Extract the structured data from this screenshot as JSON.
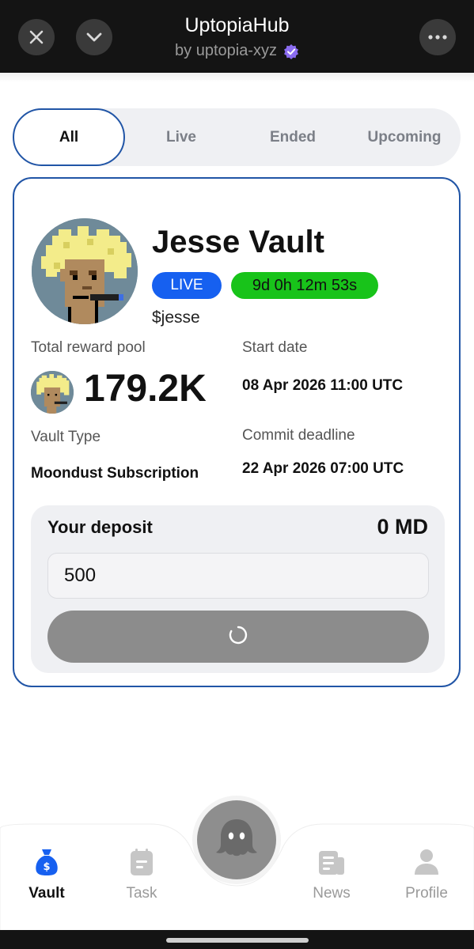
{
  "header": {
    "title": "UptopiaHub",
    "subtitle": "by uptopia-xyz",
    "close_icon": "close-icon",
    "collapse_icon": "chevron-down-icon",
    "more_icon": "more-icon"
  },
  "tabs": [
    {
      "label": "All",
      "active": true
    },
    {
      "label": "Live",
      "active": false
    },
    {
      "label": "Ended",
      "active": false
    },
    {
      "label": "Upcoming",
      "active": false
    }
  ],
  "vault": {
    "name": "Jesse Vault",
    "status": "LIVE",
    "countdown": "9d 0h 12m 53s",
    "ticker": "$jesse",
    "reward_pool_label": "Total reward pool",
    "reward_pool_value": "179.2K",
    "start_date_label": "Start date",
    "start_date_value": "08 Apr 2026 11:00 UTC",
    "vault_type_label": "Vault Type",
    "vault_type_value": "Moondust Subscription",
    "commit_deadline_label": "Commit deadline",
    "commit_deadline_value": "22 Apr 2026 07:00 UTC",
    "deposit": {
      "label": "Your deposit",
      "value": "0 MD",
      "input_value": "500"
    }
  },
  "nav": {
    "items": [
      {
        "label": "Vault",
        "icon": "money-bag-icon",
        "active": true
      },
      {
        "label": "Task",
        "icon": "task-icon",
        "active": false
      },
      {
        "label": "News",
        "icon": "news-icon",
        "active": false
      },
      {
        "label": "Profile",
        "icon": "profile-icon",
        "active": false
      }
    ],
    "center_icon": "ghost-icon"
  },
  "colors": {
    "accent_blue": "#2155a6",
    "live_badge": "#1660f0",
    "timer_badge": "#18c31a",
    "nav_active": "#1660f0"
  }
}
